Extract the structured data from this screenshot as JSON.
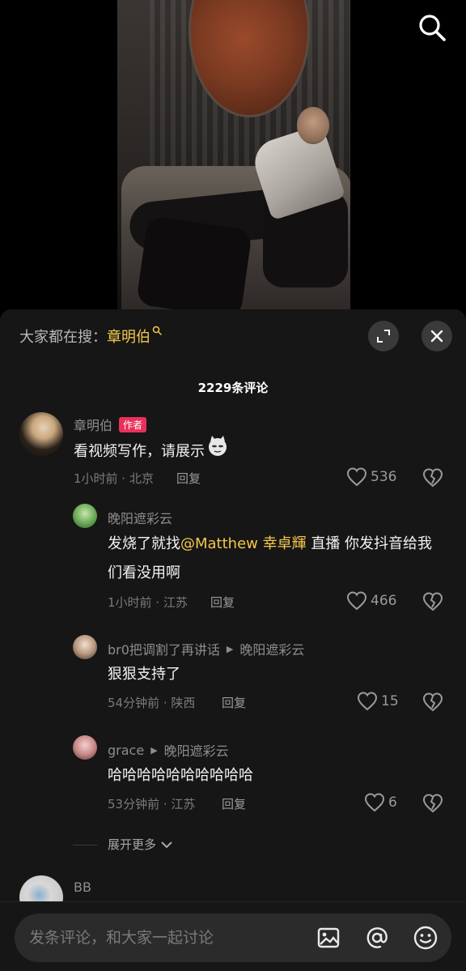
{
  "video": {
    "search_icon": "search-icon"
  },
  "panel": {
    "trending_prefix": "大家都在搜：",
    "trending_keyword": "章明伯",
    "comment_count": "2229条评论"
  },
  "comments": [
    {
      "username": "章明伯",
      "badge": "作者",
      "text": "看视频写作，请展示",
      "meta": "1小时前 · 北京",
      "reply": "回复",
      "likes": "536"
    },
    {
      "username": "晚阳遮彩云",
      "text_before": "发烧了就找",
      "mention": "@Matthew 幸卓輝",
      "text_after": " 直播 你发抖音给我",
      "text_line2": "们看没用啊",
      "meta": "1小时前 · 江苏",
      "reply": "回复",
      "likes": "466"
    },
    {
      "username": "br0把调割了再讲话",
      "reply_to": "晚阳遮彩云",
      "text": "狠狠支持了",
      "meta": "54分钟前 · 陕西",
      "reply": "回复",
      "likes": "15"
    },
    {
      "username": "grace",
      "reply_to": "晚阳遮彩云",
      "text": "哈哈哈哈哈哈哈哈哈哈",
      "meta": "53分钟前 · 江苏",
      "reply": "回复",
      "likes": "6"
    },
    {
      "username": "BB"
    }
  ],
  "more_replies": "展开更多",
  "input": {
    "placeholder": "发条评论，和大家一起讨论"
  },
  "colors": {
    "accent": "#f5c94a",
    "badge": "#e8315a",
    "panel_bg": "#161616"
  }
}
